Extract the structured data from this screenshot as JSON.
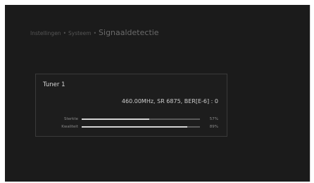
{
  "breadcrumb": {
    "item1": "Instellingen",
    "sep1": "•",
    "item2": "Systeem",
    "sep2": "•",
    "title": "Signaaldetectie"
  },
  "tuner": {
    "name": "Tuner 1",
    "info": "460.00MHz, SR 6875, BER[E-6] : 0",
    "strength_label": "Sterkte",
    "strength_value": "57%",
    "strength_fraction": 0.57,
    "quality_label": "Kwaliteit",
    "quality_value": "89%",
    "quality_fraction": 0.89
  }
}
